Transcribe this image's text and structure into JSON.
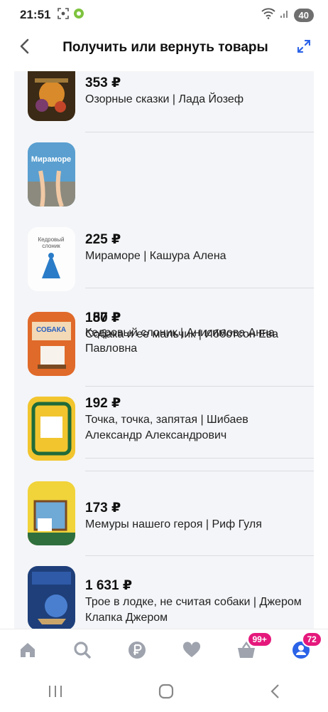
{
  "status_bar": {
    "time": "21:51",
    "battery": "40",
    "icons": [
      "screenshot-icon",
      "app-icon",
      "wifi-icon",
      "signal-icon"
    ]
  },
  "header": {
    "title": "Получить или вернуть товары",
    "back_icon": "chevron-left-icon",
    "expand_icon": "expand-icon"
  },
  "products": [
    {
      "price": "353 ₽",
      "name": "Озорные сказки | Лада Йозеф"
    },
    {
      "price": "225 ₽",
      "name": "Мираморе | Кашура Алена"
    },
    {
      "price": "157 ₽",
      "name": "Кедровый слоник | Анисимова Анна Павловна",
      "cover_title": "Кедровый слоник"
    },
    {
      "price": "180 ₽",
      "name": "Собака и ее мальчик | Ибботсон Ева"
    },
    {
      "price": "192 ₽",
      "name": "Точка, точка, запятая | Шибаев Александр Александрович"
    },
    {
      "price": "173 ₽",
      "name": "Мемуры нашего героя | Риф Гуля"
    },
    {
      "price": "1 631 ₽",
      "name": "Трое в лодке, не считая собаки | Джером Клапка Джером"
    }
  ],
  "bottom_nav": [
    {
      "icon": "home-icon"
    },
    {
      "icon": "search-icon"
    },
    {
      "icon": "ruble-icon"
    },
    {
      "icon": "heart-icon"
    },
    {
      "icon": "basket-icon",
      "badge": "99+"
    },
    {
      "icon": "profile-icon",
      "badge": "72"
    }
  ],
  "colors": {
    "accent": "#2b63e8",
    "badge": "#e5197c",
    "nav_icon": "#9ea3ad",
    "list_bg": "#f4f5f8"
  }
}
